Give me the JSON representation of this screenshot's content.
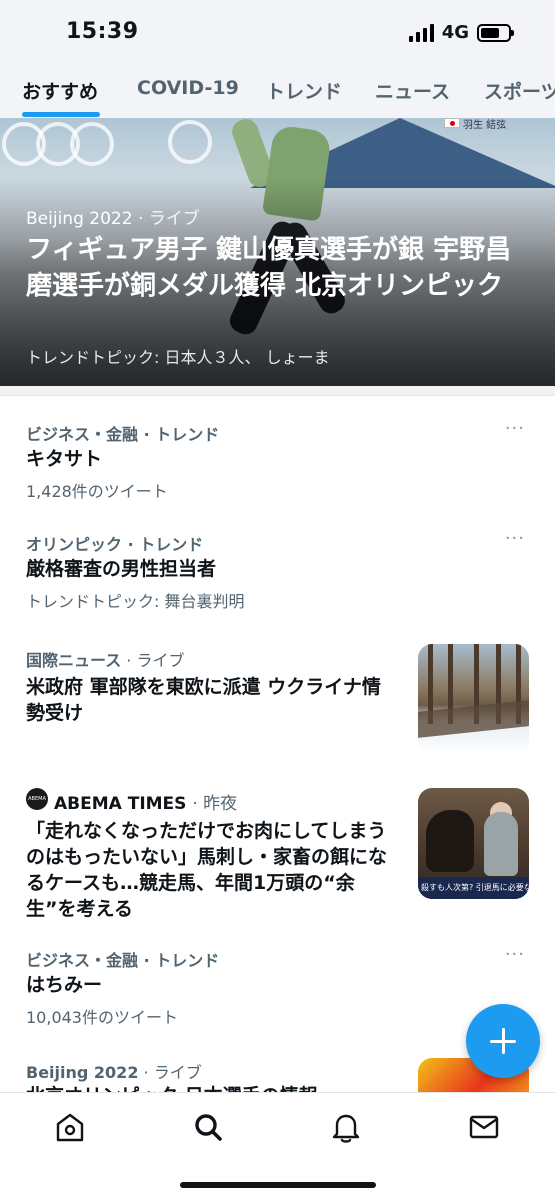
{
  "status": {
    "time": "15:39",
    "network": "4G"
  },
  "tabs": [
    {
      "label": "おすすめ",
      "active": true
    },
    {
      "label": "COVID-19",
      "active": false
    },
    {
      "label": "トレンド",
      "active": false
    },
    {
      "label": "ニュース",
      "active": false
    },
    {
      "label": "スポーツ",
      "active": false
    }
  ],
  "hero": {
    "category": "Beijing 2022",
    "live": "· ライブ",
    "title": "フィギュア男子 鍵山優真選手が銀 宇野昌磨選手が銅メダル獲得 北京オリンピック",
    "subtitle": "トレンドトピック: 日本人３人、 しょーま",
    "corner_text": "羽生 結弦"
  },
  "items": [
    {
      "category": "ビジネス・金融 · トレンド",
      "title": "キタサト",
      "count": "1,428件のツイート"
    },
    {
      "category": "オリンピック · トレンド",
      "title": "厳格審査の男性担当者",
      "count": "トレンドトピック: 舞台裏判明"
    },
    {
      "category": "国際ニュース",
      "live": " · ライブ",
      "title": "米政府 軍部隊を東欧に派遣 ウクライナ情勢受け"
    },
    {
      "source": "ABEMA TIMES",
      "time": "· 昨夜",
      "logo_text": "ABEMA TIMES",
      "title": "「走れなくなっただけでお肉にしてしまうのはもったいない」馬刺し・家畜の餌になるケースも…競走馬、年間1万頭の“余生”を考える",
      "thumb_caption": "殺すも人次第? 引退馬に必要な"
    },
    {
      "category": "ビジネス・金融 · トレンド",
      "title": "はちみー",
      "count": "10,043件のツイート"
    },
    {
      "category": "Beijing 2022",
      "live": " · ライブ",
      "title": "北京オリンピック 日本選手の情報"
    }
  ],
  "more_label": "···",
  "colors": {
    "accent": "#1d9bf0",
    "secondary_text": "#536471",
    "primary_text": "#0f1419"
  },
  "bottom_nav": [
    "home-icon",
    "search-icon",
    "bell-icon",
    "mail-icon"
  ]
}
